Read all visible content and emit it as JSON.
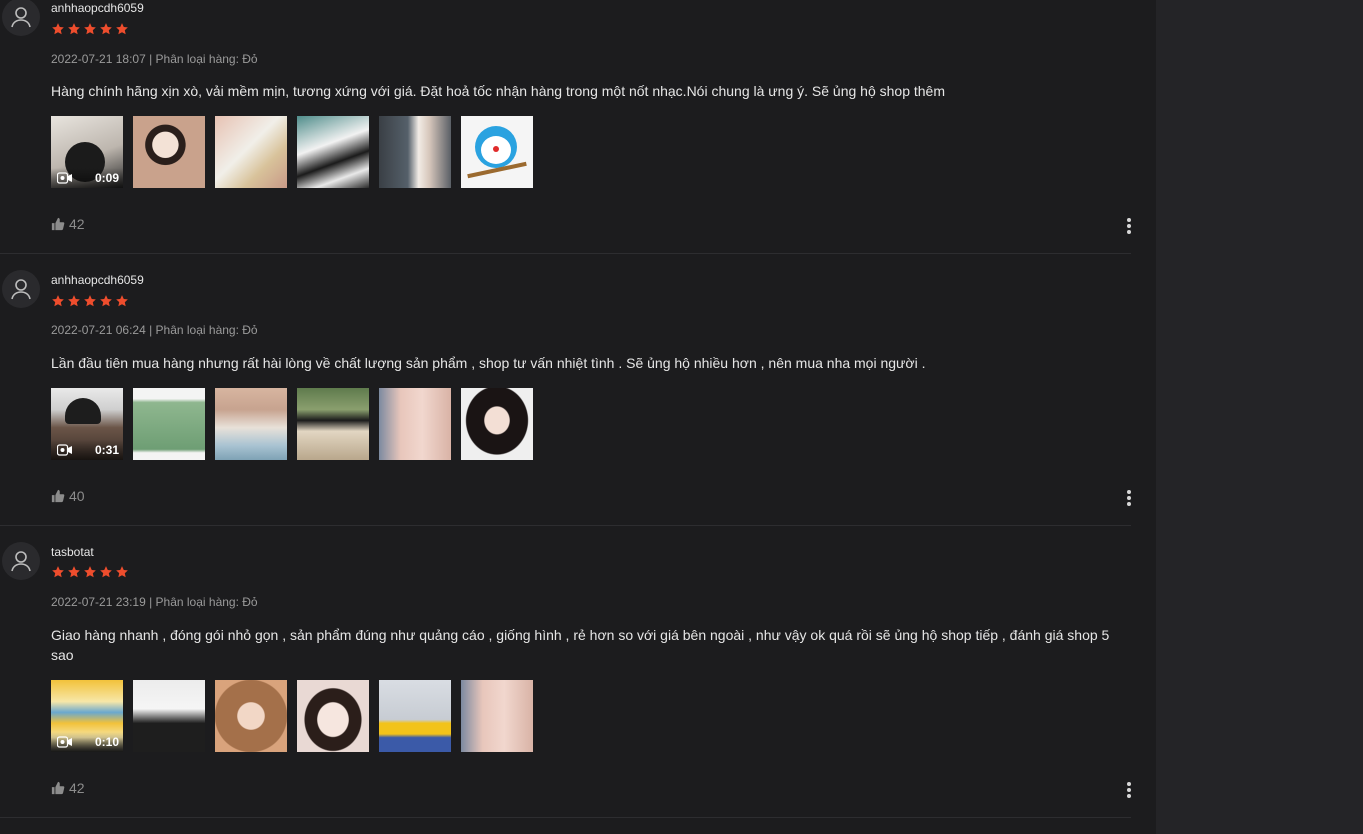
{
  "colors": {
    "star": "#ee4d2d",
    "background": "#1c1c1e",
    "sidebar": "#242427"
  },
  "reviews": [
    {
      "username": "anhhaopcdh6059",
      "rating": 5,
      "meta": "2022-07-21 18:07 | Phân loại hàng: Đỏ",
      "comment": "Hàng chính hãng xịn xò, vải mềm mịn, tương xứng với giá. Đặt hoả tốc nhận hàng trong một nốt nhạc.Nói chung là ưng ý. Sẽ ủng hộ shop thêm",
      "video_duration": "0:09",
      "likes": "42",
      "media_icons": [
        "video-thumbnail-icon",
        "girl-photo-icon",
        "sneaker-photo-icon",
        "sneaker-photo-icon",
        "dress-photo-icon",
        "doraemon-photo-icon"
      ]
    },
    {
      "username": "anhhaopcdh6059",
      "rating": 5,
      "meta": "2022-07-21 06:24 | Phân loại hàng: Đỏ",
      "comment": "Lần đầu tiên mua hàng nhưng rất hài lòng về chất lượng sản phẩm , shop tư vấn nhiệt tình . Sẽ ủng hộ nhiều hơn , nên mua nha mọi người .",
      "video_duration": "0:31",
      "likes": "40",
      "media_icons": [
        "video-thumbnail-icon",
        "green-dress-photo-icon",
        "outfit-photo-icon",
        "outfit-photo-icon",
        "pink-outfit-photo-icon",
        "girl-portrait-photo-icon"
      ]
    },
    {
      "username": "tasbotat",
      "rating": 5,
      "meta": "2022-07-21 23:19 | Phân loại hàng: Đỏ",
      "comment": "Giao hàng nhanh , đóng gói nhỏ gọn , sản phẩm đúng như quảng cáo , giống hình , rẻ hơn so với giá bên ngoài , như vậy ok quá rồi sẽ ủng hộ shop tiếp , đánh giá shop 5 sao",
      "video_duration": "0:10",
      "likes": "42",
      "media_icons": [
        "video-thumbnail-icon",
        "polka-top-photo-icon",
        "girl-glasses-photo-icon",
        "girl-selfie-photo-icon",
        "minions-photo-icon",
        "pink-outfit-photo-icon"
      ]
    }
  ]
}
